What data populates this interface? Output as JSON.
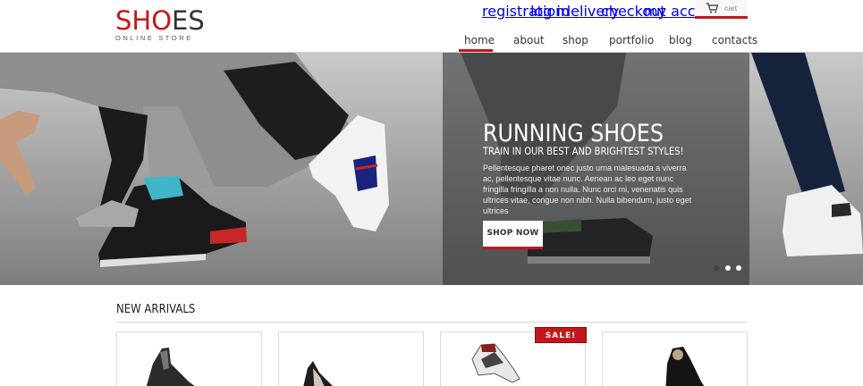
{
  "logo": {
    "main_red": "SHO",
    "main_dark": "ES",
    "sub": "ONLINE STORE"
  },
  "top_links": [
    "registration",
    "log in",
    "delivery",
    "checkout",
    "my account"
  ],
  "cart": {
    "label": "cart",
    "icon": "cart-icon"
  },
  "nav": {
    "items": [
      "home",
      "about",
      "shop",
      "portfolio",
      "blog",
      "contacts"
    ],
    "active": "home"
  },
  "hero": {
    "title": "RUNNING SHOES",
    "subtitle": "TRAIN IN OUR BEST AND BRIGHTEST STYLES!",
    "text": "Pellentesque pharet onec justo urna malesuada a viverra ac, pellentesque vitae nunc. Aenean ac leo eget nunc fringilla fringilla a non nulla. Nunc orci mi, venenatis quis ultrices vitae, congue non nibh. Nulla bibendum, justo eget ultrices",
    "button": "SHOP NOW",
    "slides": 3,
    "active_slide": 1
  },
  "section": {
    "title": "NEW ARRIVALS"
  },
  "products": [
    {
      "badge": ""
    },
    {
      "badge": ""
    },
    {
      "badge": "SALE!"
    },
    {
      "badge": ""
    }
  ],
  "colors": {
    "accent": "#c4161c",
    "text": "#333333"
  }
}
